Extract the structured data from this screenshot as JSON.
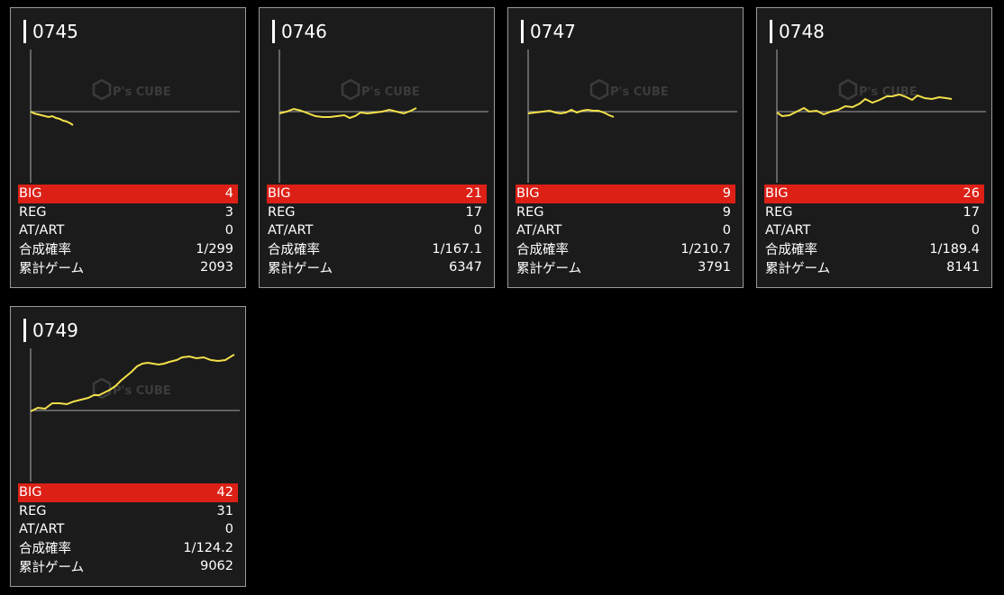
{
  "labels": {
    "big": "BIG",
    "reg": "REG",
    "atart": "AT/ART",
    "prob": "合成確率",
    "games": "累計ゲーム"
  },
  "watermark": {
    "brand": "P's CUBE"
  },
  "colors": {
    "big_bg": "#dc2016",
    "line": "#f2e04a",
    "card_bg": "#1b1b1b",
    "border": "#9a9a9a"
  },
  "machines": [
    {
      "number": "0745",
      "big": "4",
      "reg": "3",
      "atart": "0",
      "prob": "1/299",
      "games": "2093"
    },
    {
      "number": "0746",
      "big": "21",
      "reg": "17",
      "atart": "0",
      "prob": "1/167.1",
      "games": "6347"
    },
    {
      "number": "0747",
      "big": "9",
      "reg": "9",
      "atart": "0",
      "prob": "1/210.7",
      "games": "3791"
    },
    {
      "number": "0748",
      "big": "26",
      "reg": "17",
      "atart": "0",
      "prob": "1/189.4",
      "games": "8141"
    },
    {
      "number": "0749",
      "big": "42",
      "reg": "31",
      "atart": "0",
      "prob": "1/124.2",
      "games": "9062"
    }
  ]
}
